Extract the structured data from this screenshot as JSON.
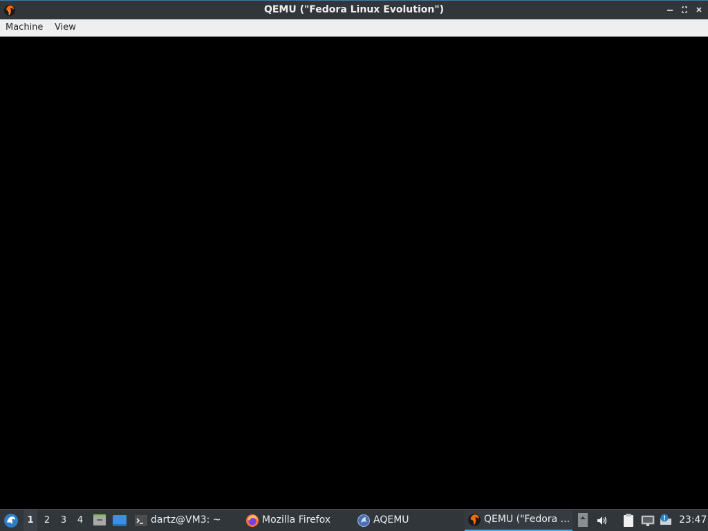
{
  "window": {
    "title": "QEMU (\"Fedora Linux Evolution\")",
    "minimize_icon": "minimize-icon",
    "maximize_icon": "restore-icon",
    "close_icon": "close-icon"
  },
  "menubar": {
    "items": [
      {
        "label": "Machine"
      },
      {
        "label": "View"
      }
    ]
  },
  "taskbar": {
    "desktops": [
      "1",
      "2",
      "3",
      "4"
    ],
    "active_desktop": "1",
    "tasks": [
      {
        "label": "dartz@VM3: ~",
        "icon": "terminal-icon"
      },
      {
        "label": "Mozilla Firefox",
        "icon": "firefox-icon"
      },
      {
        "label": "AQEMU",
        "icon": "aqemu-icon"
      },
      {
        "label": "QEMU (\"Fedora ...",
        "icon": "qemu-icon",
        "active": true
      }
    ],
    "clock": "23:47"
  },
  "colors": {
    "titlebar": "#31363b",
    "taskbar": "#31363b",
    "accent": "#3daee9",
    "menubar": "#efefef",
    "display": "#000000"
  }
}
